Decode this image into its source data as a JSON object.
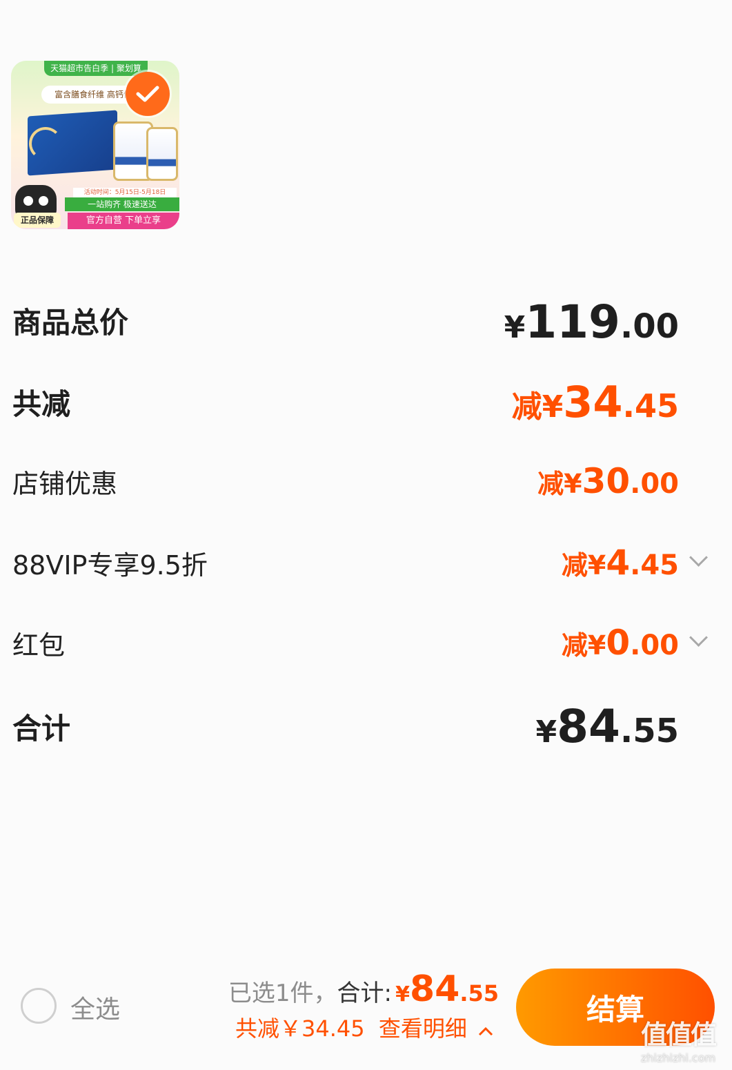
{
  "product": {
    "image_top_banner": "天猫超市告白季 | 聚划算",
    "image_tagline": "富含膳食纤维 高钙低",
    "image_promo_period": "活动时间：5月15日-5月18日",
    "image_green_strip": "一站购齐 极速送达",
    "image_bottom_strip": "官方自营 下单立享",
    "image_badge": "正品保障",
    "selected": true
  },
  "breakdown": {
    "total_price": {
      "label": "商品总价",
      "currency": "¥",
      "integer": "119",
      "decimal": ".00"
    },
    "total_discount": {
      "label": "共减",
      "prefix": "减¥",
      "integer": "34",
      "decimal": ".45"
    },
    "store_discount": {
      "label": "店铺优惠",
      "prefix": "减¥",
      "integer": "30",
      "decimal": ".00"
    },
    "vip_discount": {
      "label": "88VIP专享9.5折",
      "prefix": "减¥",
      "integer": "4",
      "decimal": ".45"
    },
    "red_packet": {
      "label": "红包",
      "prefix": "减¥",
      "integer": "0",
      "decimal": ".00"
    },
    "grand_total": {
      "label": "合计",
      "currency": "¥",
      "integer": "84",
      "decimal": ".55"
    }
  },
  "bottom_bar": {
    "select_all_label": "全选",
    "selected_count_text": "已选1件，",
    "total_label": "合计:",
    "total_currency": "¥",
    "total_integer": "84",
    "total_decimal": ".55",
    "discount_text": "共减￥34.45",
    "details_link": "查看明细",
    "checkout_label": "结算"
  },
  "watermark": {
    "logo": "值值值",
    "url": "zhizhizhi.com"
  },
  "colors": {
    "accent": "#ff5000",
    "checkout_start": "#ff9a00",
    "checkout_end": "#ff5000"
  }
}
